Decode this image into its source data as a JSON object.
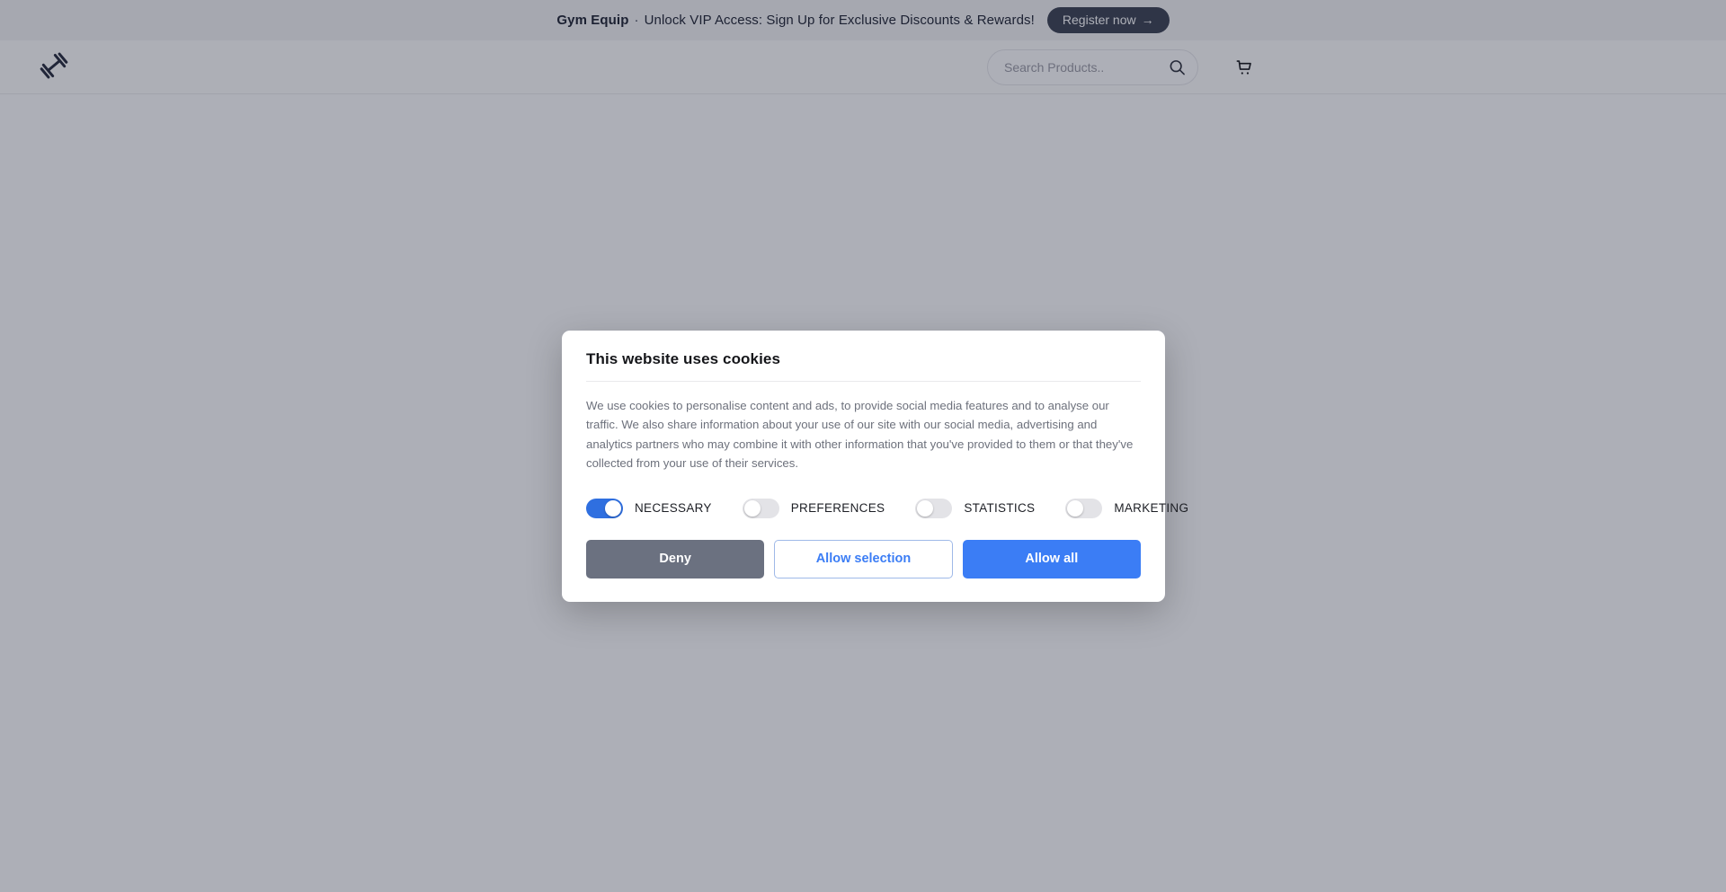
{
  "promo": {
    "brand": "Gym Equip",
    "separator": "·",
    "message": "Unlock VIP Access: Sign Up for Exclusive Discounts & Rewards!",
    "register_label": "Register now",
    "register_arrow": "→",
    "background": "#f4f4f5",
    "button_background": "#3b4150"
  },
  "header": {
    "logo_icon": "dumbbell-icon",
    "search": {
      "placeholder": "Search Products..",
      "value": "",
      "icon": "search-icon"
    },
    "cart_icon": "shopping-cart-icon"
  },
  "overlay": {
    "color": "#1c2238",
    "opacity": "0.36"
  },
  "cookie_modal": {
    "title": "This website uses cookies",
    "body": "We use cookies to personalise content and ads, to provide social media features and to analyse our traffic. We also share information about your use of our site with our social media, advertising and analytics partners who may combine it with other information that you've provided to them or that they've collected from your use of their services.",
    "toggles": [
      {
        "label": "NECESSARY",
        "on": true
      },
      {
        "label": "PREFERENCES",
        "on": false
      },
      {
        "label": "STATISTICS",
        "on": false
      },
      {
        "label": "MARKETING",
        "on": false
      }
    ],
    "buttons": {
      "deny": "Deny",
      "allow_selection": "Allow selection",
      "allow_all": "Allow all"
    },
    "colors": {
      "accent_blue": "#3b7df5",
      "toggle_on": "#2f6fe0",
      "deny_gray": "#6b7180"
    }
  }
}
